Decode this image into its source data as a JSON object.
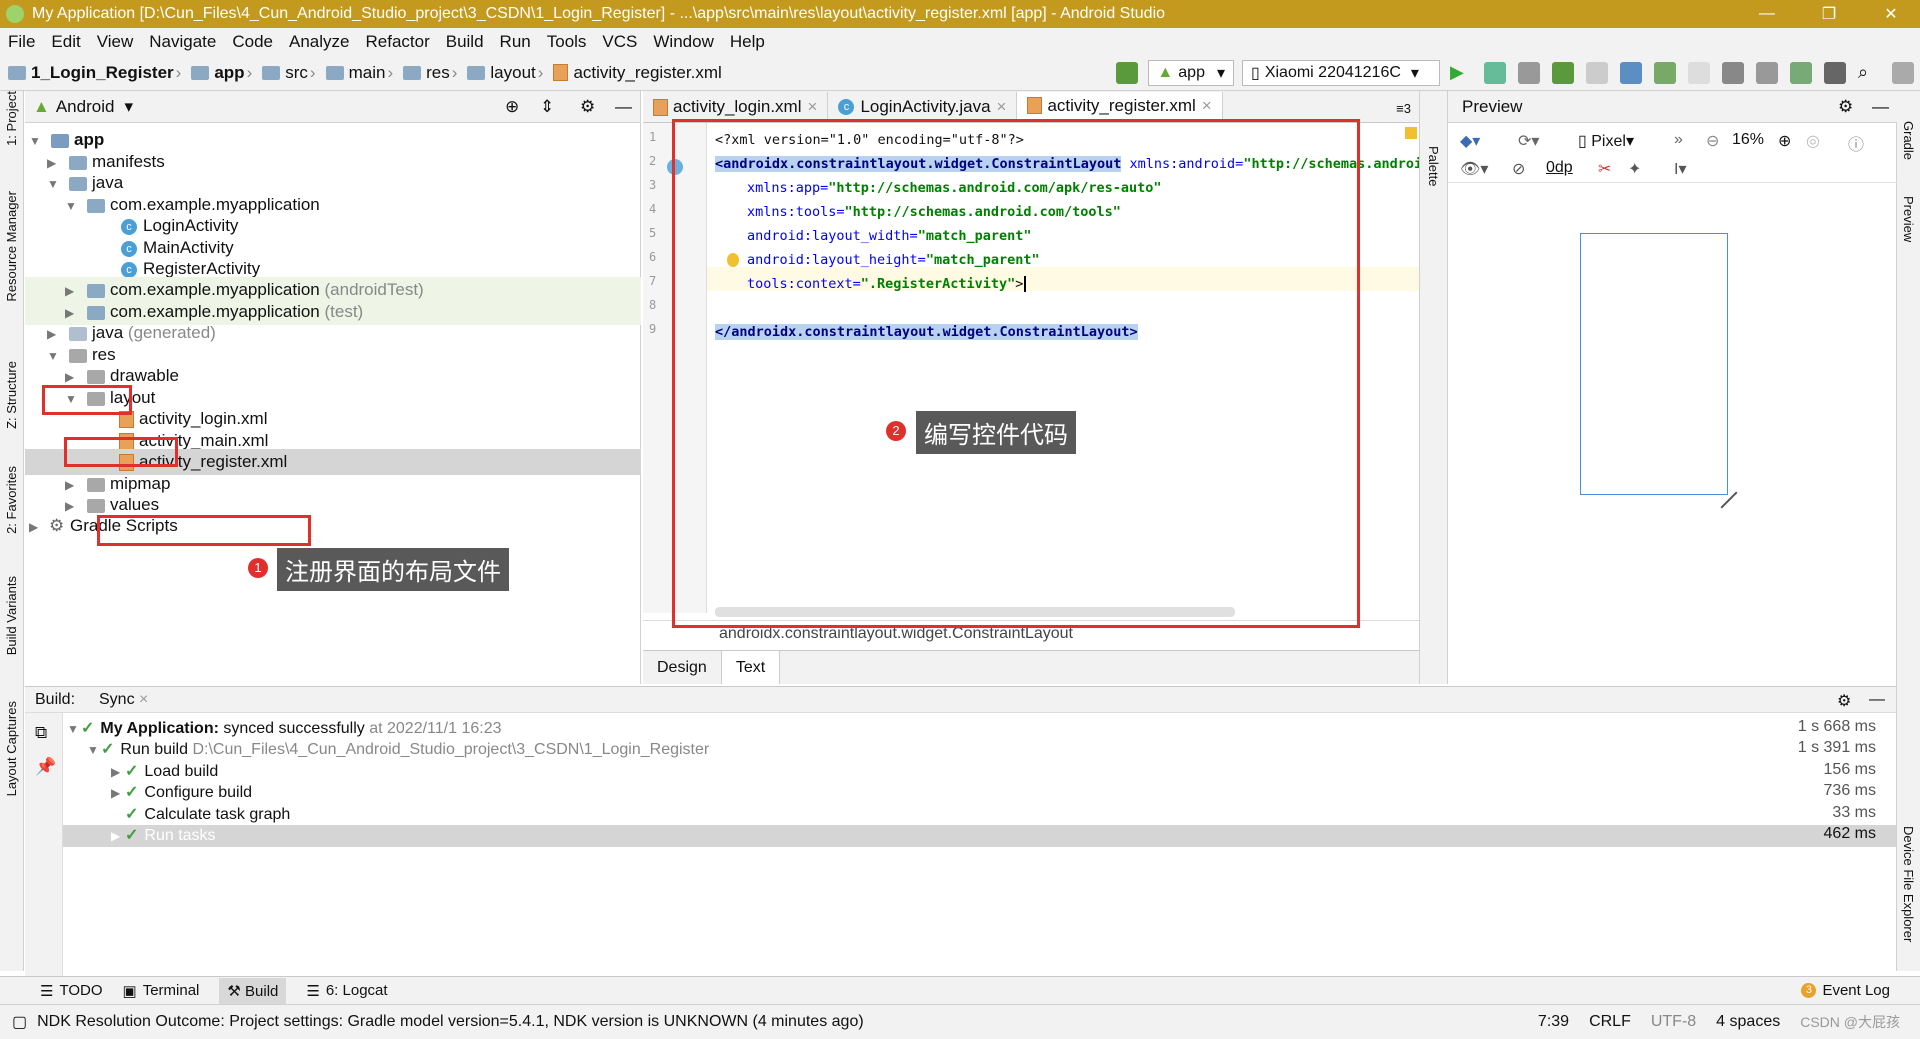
{
  "window": {
    "title": "My Application [D:\\Cun_Files\\4_Cun_Android_Studio_project\\3_CSDN\\1_Login_Register] - ...\\app\\src\\main\\res\\layout\\activity_register.xml [app] - Android Studio"
  },
  "menu": [
    "File",
    "Edit",
    "View",
    "Navigate",
    "Code",
    "Analyze",
    "Refactor",
    "Build",
    "Run",
    "Tools",
    "VCS",
    "Window",
    "Help"
  ],
  "breadcrumb": [
    "1_Login_Register",
    "app",
    "src",
    "main",
    "res",
    "layout",
    "activity_register.xml"
  ],
  "toolbar": {
    "config": "app",
    "device": "Xiaomi 22041216C"
  },
  "left_strip": [
    "1: Project",
    "Resource Manager",
    "Z: Structure",
    "2: Favorites",
    "Build Variants",
    "Layout Captures"
  ],
  "right_strip": [
    "Gradle",
    "Preview",
    "Device File Explorer"
  ],
  "project": {
    "view": "Android",
    "tree": [
      {
        "label": "app",
        "extra": ""
      },
      {
        "label": "manifests",
        "extra": ""
      },
      {
        "label": "java",
        "extra": ""
      },
      {
        "label": "com.example.myapplication",
        "extra": ""
      },
      {
        "label": "LoginActivity",
        "extra": ""
      },
      {
        "label": "MainActivity",
        "extra": ""
      },
      {
        "label": "RegisterActivity",
        "extra": ""
      },
      {
        "label": "com.example.myapplication",
        "extra": "(androidTest)"
      },
      {
        "label": "com.example.myapplication",
        "extra": "(test)"
      },
      {
        "label": "java",
        "extra": "(generated)"
      },
      {
        "label": "res",
        "extra": ""
      },
      {
        "label": "drawable",
        "extra": ""
      },
      {
        "label": "layout",
        "extra": ""
      },
      {
        "label": "activity_login.xml",
        "extra": ""
      },
      {
        "label": "activity_main.xml",
        "extra": ""
      },
      {
        "label": "activity_register.xml",
        "extra": ""
      },
      {
        "label": "mipmap",
        "extra": ""
      },
      {
        "label": "values",
        "extra": ""
      },
      {
        "label": "Gradle Scripts",
        "extra": ""
      }
    ]
  },
  "annotations": {
    "badge1": "1",
    "callout1": "注册界面的布局文件",
    "badge2": "2",
    "callout2": "编写控件代码"
  },
  "editor": {
    "tabs": [
      "activity_login.xml",
      "LoginActivity.java",
      "activity_register.xml"
    ],
    "line_numbers": [
      "1",
      "2",
      "3",
      "4",
      "5",
      "6",
      "7",
      "8",
      "9"
    ],
    "code": {
      "l1": "<?xml version=\"1.0\" encoding=\"utf-8\"?>",
      "l2_tag": "<androidx.constraintlayout.widget.ConstraintLayout",
      "l2_attr": " xmlns:android=",
      "l2_val": "\"http://schemas.android",
      "l3_attr": "xmlns:app=",
      "l3_val": "\"http://schemas.android.com/apk/res-auto\"",
      "l4_attr": "xmlns:tools=",
      "l4_val": "\"http://schemas.android.com/tools\"",
      "l5_attr": "android:layout_width=",
      "l5_val": "\"match_parent\"",
      "l6_attr": "android:layout_height=",
      "l6_val": "\"match_parent\"",
      "l7_attr": "tools:context=",
      "l7_val": "\".RegisterActivity\"",
      "l7_end": ">",
      "l9": "</androidx.constraintlayout.widget.ConstraintLayout>"
    },
    "status_path": "androidx.constraintlayout.widget.ConstraintLayout",
    "bottom_tabs": [
      "Design",
      "Text"
    ]
  },
  "preview": {
    "title": "Preview",
    "device": "Pixel",
    "zoom": "16%",
    "margin": "0dp",
    "palette": "Palette"
  },
  "build": {
    "tabs": [
      "Build:",
      "Sync"
    ],
    "rows": [
      {
        "label": "My Application:",
        "detail": "synced successfully",
        "extra": "at 2022/11/1 16:23",
        "time": "1 s 668 ms"
      },
      {
        "label": "Run build",
        "detail": "",
        "extra": "D:\\Cun_Files\\4_Cun_Android_Studio_project\\3_CSDN\\1_Login_Register",
        "time": "1 s 391 ms"
      },
      {
        "label": "Load build",
        "detail": "",
        "extra": "",
        "time": "156 ms"
      },
      {
        "label": "Configure build",
        "detail": "",
        "extra": "",
        "time": "736 ms"
      },
      {
        "label": "Calculate task graph",
        "detail": "",
        "extra": "",
        "time": "33 ms"
      },
      {
        "label": "Run tasks",
        "detail": "",
        "extra": "",
        "time": "462 ms"
      }
    ]
  },
  "bottom_tools": [
    "TODO",
    "Terminal",
    "Build",
    "6: Logcat",
    "Event Log"
  ],
  "event_count": "3",
  "status": {
    "message": "NDK Resolution Outcome: Project settings: Gradle model version=5.4.1, NDK version is UNKNOWN (4 minutes ago)",
    "position": "7:39",
    "line_sep": "CRLF",
    "encoding": "UTF-8",
    "indent": "4 spaces",
    "watermark": "CSDN @大屁孩"
  }
}
